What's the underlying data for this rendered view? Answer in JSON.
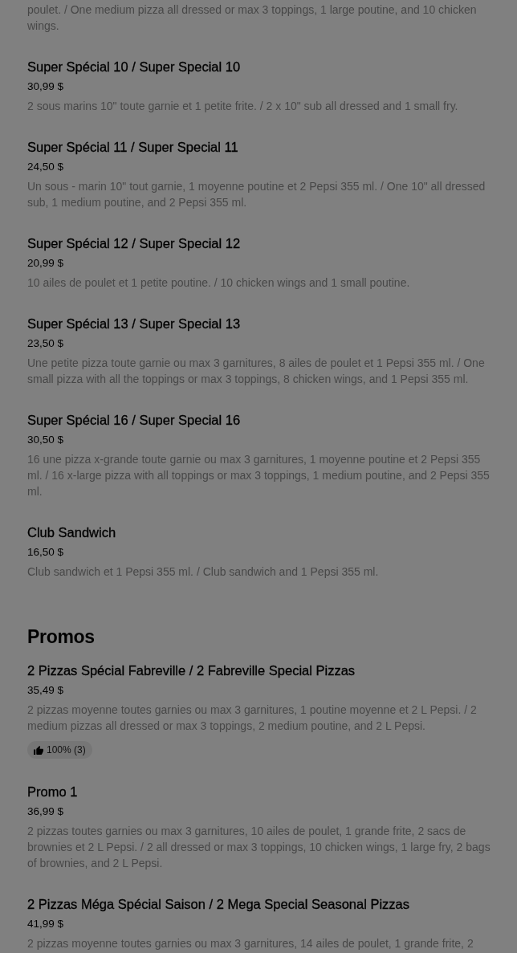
{
  "menu_sections": [
    {
      "items": [
        {
          "description": "poulet. / One medium pizza all dressed or max 3 toppings, 1 large poutine, and 10 chicken wings."
        },
        {
          "name": "Super Spécial 10 / Super Special 10",
          "price": "30,99 $",
          "description": "2 sous marins 10\" toute garnie et 1 petite frite. / 2 x 10\" sub all dressed and 1 small fry."
        },
        {
          "name": "Super Spécial 11 / Super Special 11",
          "price": "24,50 $",
          "description": "Un sous - marin 10\" tout garnie, 1 moyenne poutine et 2 Pepsi 355 ml. / One 10\" all dressed sub, 1 medium poutine, and 2 Pepsi 355 ml."
        },
        {
          "name": "Super Spécial 12 / Super Special 12",
          "price": "20,99 $",
          "description": "10 ailes de poulet et 1 petite poutine. / 10 chicken wings and 1 small poutine."
        },
        {
          "name": "Super Spécial 13 / Super Special 13",
          "price": "23,50 $",
          "description": "Une petite pizza toute garnie ou max 3 garnitures, 8 ailes de poulet et 1 Pepsi 355 ml. / One small pizza with all the toppings or max 3 toppings, 8 chicken wings, and 1 Pepsi 355 ml."
        },
        {
          "name": "Super Spécial 16 / Super Special 16",
          "price": "30,50 $",
          "description": "16 une pizza x-grande toute garnie ou max 3 garnitures, 1 moyenne poutine et 2 Pepsi 355 ml. / 16 x-large pizza with all toppings or max 3 toppings, 1 medium poutine, and 2 Pepsi 355 ml."
        },
        {
          "name": "Club Sandwich",
          "price": "16,50 $",
          "description": "Club sandwich et 1 Pepsi 355 ml. / Club sandwich and 1 Pepsi 355 ml."
        }
      ]
    },
    {
      "heading": "Promos",
      "items": [
        {
          "name": "2 Pizzas Spécial Fabreville / 2 Fabreville Special Pizzas",
          "price": "35,49 $",
          "description": "2 pizzas moyenne toutes garnies ou max 3 garnitures, 1 poutine moyenne et 2 L Pepsi. / 2 medium pizzas all dressed or max 3 toppings, 2 medium poutine, and 2 L Pepsi.",
          "rating": "100% (3)"
        },
        {
          "name": "Promo 1",
          "price": "36,99 $",
          "description": "2 pizzas toutes garnies ou max 3 garnitures, 10 ailes de poulet, 1 grande frite, 2 sacs de brownies et 2 L Pepsi. / 2 all dressed or max 3 toppings, 10 chicken wings, 1 large fry, 2 bags of brownies, and 2 L Pepsi."
        },
        {
          "name": "2 Pizzas Méga Spécial Saison / 2 Mega Special Seasonal Pizzas",
          "price": "41,99 $",
          "description": "2 pizzas moyenne toutes garnies ou max 3 garnitures, 14 ailes de poulet, 1 grande frite, 2"
        }
      ]
    }
  ]
}
